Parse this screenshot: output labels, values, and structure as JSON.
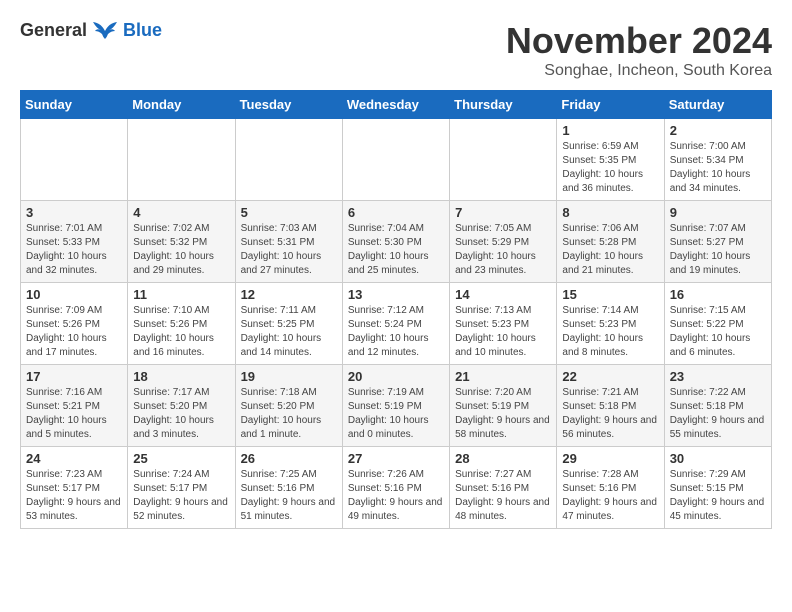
{
  "logo": {
    "general": "General",
    "blue": "Blue"
  },
  "title": "November 2024",
  "subtitle": "Songhae, Incheon, South Korea",
  "headers": [
    "Sunday",
    "Monday",
    "Tuesday",
    "Wednesday",
    "Thursday",
    "Friday",
    "Saturday"
  ],
  "weeks": [
    {
      "days": [
        {
          "num": "",
          "info": ""
        },
        {
          "num": "",
          "info": ""
        },
        {
          "num": "",
          "info": ""
        },
        {
          "num": "",
          "info": ""
        },
        {
          "num": "",
          "info": ""
        },
        {
          "num": "1",
          "info": "Sunrise: 6:59 AM\nSunset: 5:35 PM\nDaylight: 10 hours and 36 minutes."
        },
        {
          "num": "2",
          "info": "Sunrise: 7:00 AM\nSunset: 5:34 PM\nDaylight: 10 hours and 34 minutes."
        }
      ]
    },
    {
      "days": [
        {
          "num": "3",
          "info": "Sunrise: 7:01 AM\nSunset: 5:33 PM\nDaylight: 10 hours and 32 minutes."
        },
        {
          "num": "4",
          "info": "Sunrise: 7:02 AM\nSunset: 5:32 PM\nDaylight: 10 hours and 29 minutes."
        },
        {
          "num": "5",
          "info": "Sunrise: 7:03 AM\nSunset: 5:31 PM\nDaylight: 10 hours and 27 minutes."
        },
        {
          "num": "6",
          "info": "Sunrise: 7:04 AM\nSunset: 5:30 PM\nDaylight: 10 hours and 25 minutes."
        },
        {
          "num": "7",
          "info": "Sunrise: 7:05 AM\nSunset: 5:29 PM\nDaylight: 10 hours and 23 minutes."
        },
        {
          "num": "8",
          "info": "Sunrise: 7:06 AM\nSunset: 5:28 PM\nDaylight: 10 hours and 21 minutes."
        },
        {
          "num": "9",
          "info": "Sunrise: 7:07 AM\nSunset: 5:27 PM\nDaylight: 10 hours and 19 minutes."
        }
      ]
    },
    {
      "days": [
        {
          "num": "10",
          "info": "Sunrise: 7:09 AM\nSunset: 5:26 PM\nDaylight: 10 hours and 17 minutes."
        },
        {
          "num": "11",
          "info": "Sunrise: 7:10 AM\nSunset: 5:26 PM\nDaylight: 10 hours and 16 minutes."
        },
        {
          "num": "12",
          "info": "Sunrise: 7:11 AM\nSunset: 5:25 PM\nDaylight: 10 hours and 14 minutes."
        },
        {
          "num": "13",
          "info": "Sunrise: 7:12 AM\nSunset: 5:24 PM\nDaylight: 10 hours and 12 minutes."
        },
        {
          "num": "14",
          "info": "Sunrise: 7:13 AM\nSunset: 5:23 PM\nDaylight: 10 hours and 10 minutes."
        },
        {
          "num": "15",
          "info": "Sunrise: 7:14 AM\nSunset: 5:23 PM\nDaylight: 10 hours and 8 minutes."
        },
        {
          "num": "16",
          "info": "Sunrise: 7:15 AM\nSunset: 5:22 PM\nDaylight: 10 hours and 6 minutes."
        }
      ]
    },
    {
      "days": [
        {
          "num": "17",
          "info": "Sunrise: 7:16 AM\nSunset: 5:21 PM\nDaylight: 10 hours and 5 minutes."
        },
        {
          "num": "18",
          "info": "Sunrise: 7:17 AM\nSunset: 5:20 PM\nDaylight: 10 hours and 3 minutes."
        },
        {
          "num": "19",
          "info": "Sunrise: 7:18 AM\nSunset: 5:20 PM\nDaylight: 10 hours and 1 minute."
        },
        {
          "num": "20",
          "info": "Sunrise: 7:19 AM\nSunset: 5:19 PM\nDaylight: 10 hours and 0 minutes."
        },
        {
          "num": "21",
          "info": "Sunrise: 7:20 AM\nSunset: 5:19 PM\nDaylight: 9 hours and 58 minutes."
        },
        {
          "num": "22",
          "info": "Sunrise: 7:21 AM\nSunset: 5:18 PM\nDaylight: 9 hours and 56 minutes."
        },
        {
          "num": "23",
          "info": "Sunrise: 7:22 AM\nSunset: 5:18 PM\nDaylight: 9 hours and 55 minutes."
        }
      ]
    },
    {
      "days": [
        {
          "num": "24",
          "info": "Sunrise: 7:23 AM\nSunset: 5:17 PM\nDaylight: 9 hours and 53 minutes."
        },
        {
          "num": "25",
          "info": "Sunrise: 7:24 AM\nSunset: 5:17 PM\nDaylight: 9 hours and 52 minutes."
        },
        {
          "num": "26",
          "info": "Sunrise: 7:25 AM\nSunset: 5:16 PM\nDaylight: 9 hours and 51 minutes."
        },
        {
          "num": "27",
          "info": "Sunrise: 7:26 AM\nSunset: 5:16 PM\nDaylight: 9 hours and 49 minutes."
        },
        {
          "num": "28",
          "info": "Sunrise: 7:27 AM\nSunset: 5:16 PM\nDaylight: 9 hours and 48 minutes."
        },
        {
          "num": "29",
          "info": "Sunrise: 7:28 AM\nSunset: 5:16 PM\nDaylight: 9 hours and 47 minutes."
        },
        {
          "num": "30",
          "info": "Sunrise: 7:29 AM\nSunset: 5:15 PM\nDaylight: 9 hours and 45 minutes."
        }
      ]
    }
  ]
}
